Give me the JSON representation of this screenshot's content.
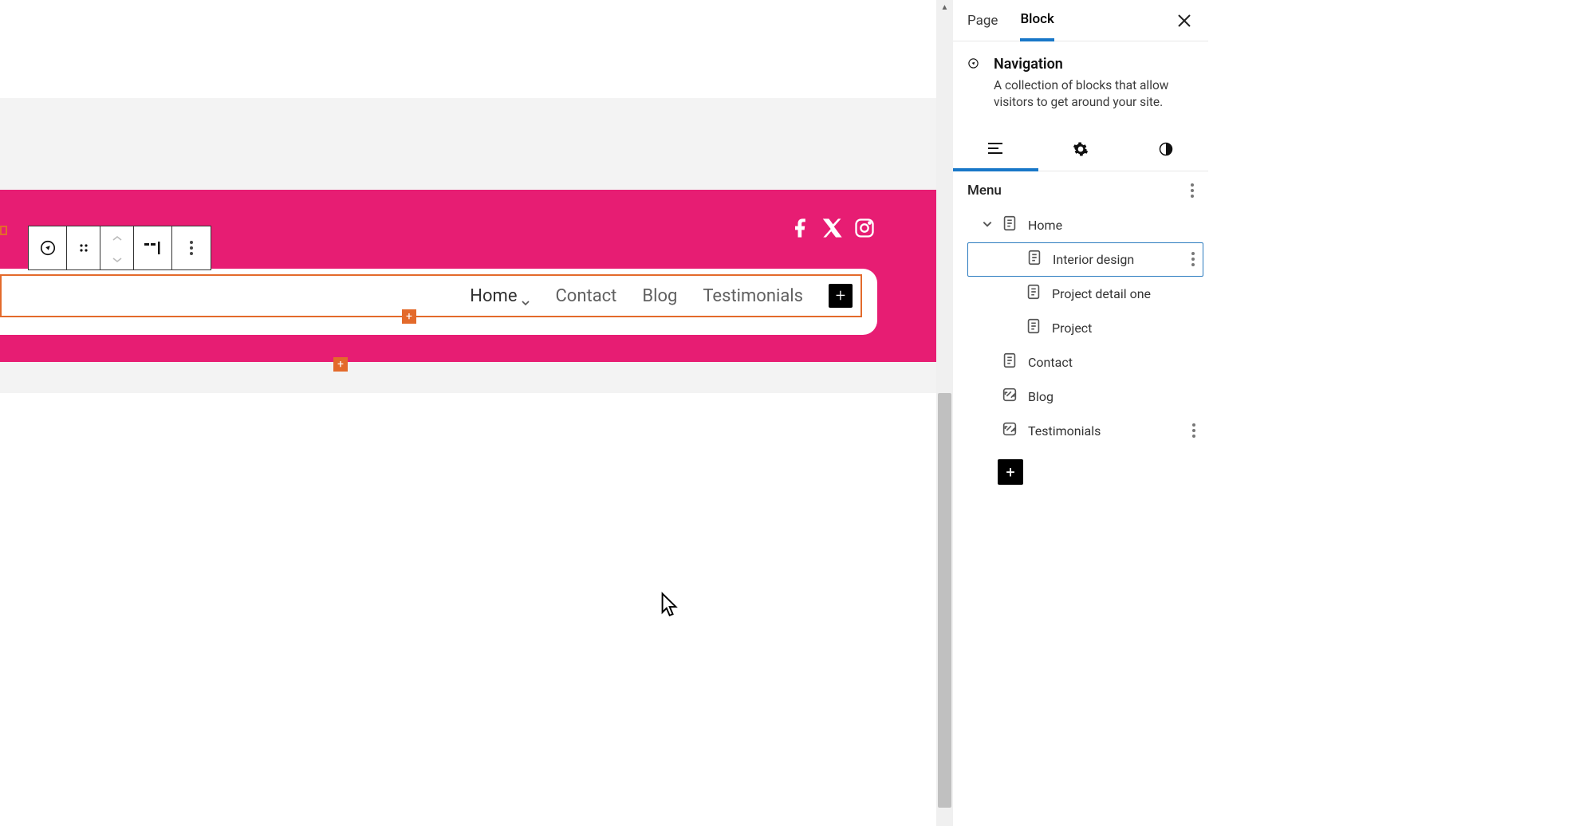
{
  "sidebar": {
    "tabs": {
      "page": "Page",
      "block": "Block"
    },
    "block_name": "Navigation",
    "block_desc": "A collection of blocks that allow visitors to get around your site.",
    "menu_label": "Menu",
    "items": [
      {
        "label": "Home",
        "type": "page",
        "level": 0,
        "expanded": true
      },
      {
        "label": "Interior design",
        "type": "page",
        "level": 1,
        "selected": true
      },
      {
        "label": "Project detail one",
        "type": "page",
        "level": 1
      },
      {
        "label": "Project",
        "type": "page",
        "level": 1
      },
      {
        "label": "Contact",
        "type": "page",
        "level": 0
      },
      {
        "label": "Blog",
        "type": "link",
        "level": 0
      },
      {
        "label": "Testimonials",
        "type": "link",
        "level": 0
      }
    ]
  },
  "nav": {
    "items": [
      {
        "label": "Home",
        "has_submenu": true
      },
      {
        "label": "Contact"
      },
      {
        "label": "Blog"
      },
      {
        "label": "Testimonials"
      }
    ]
  },
  "social": [
    "facebook",
    "x-twitter",
    "instagram"
  ],
  "colors": {
    "accent_pink": "#e71d73",
    "selection_orange": "#e36a2b",
    "wp_blue": "#1877c8"
  }
}
